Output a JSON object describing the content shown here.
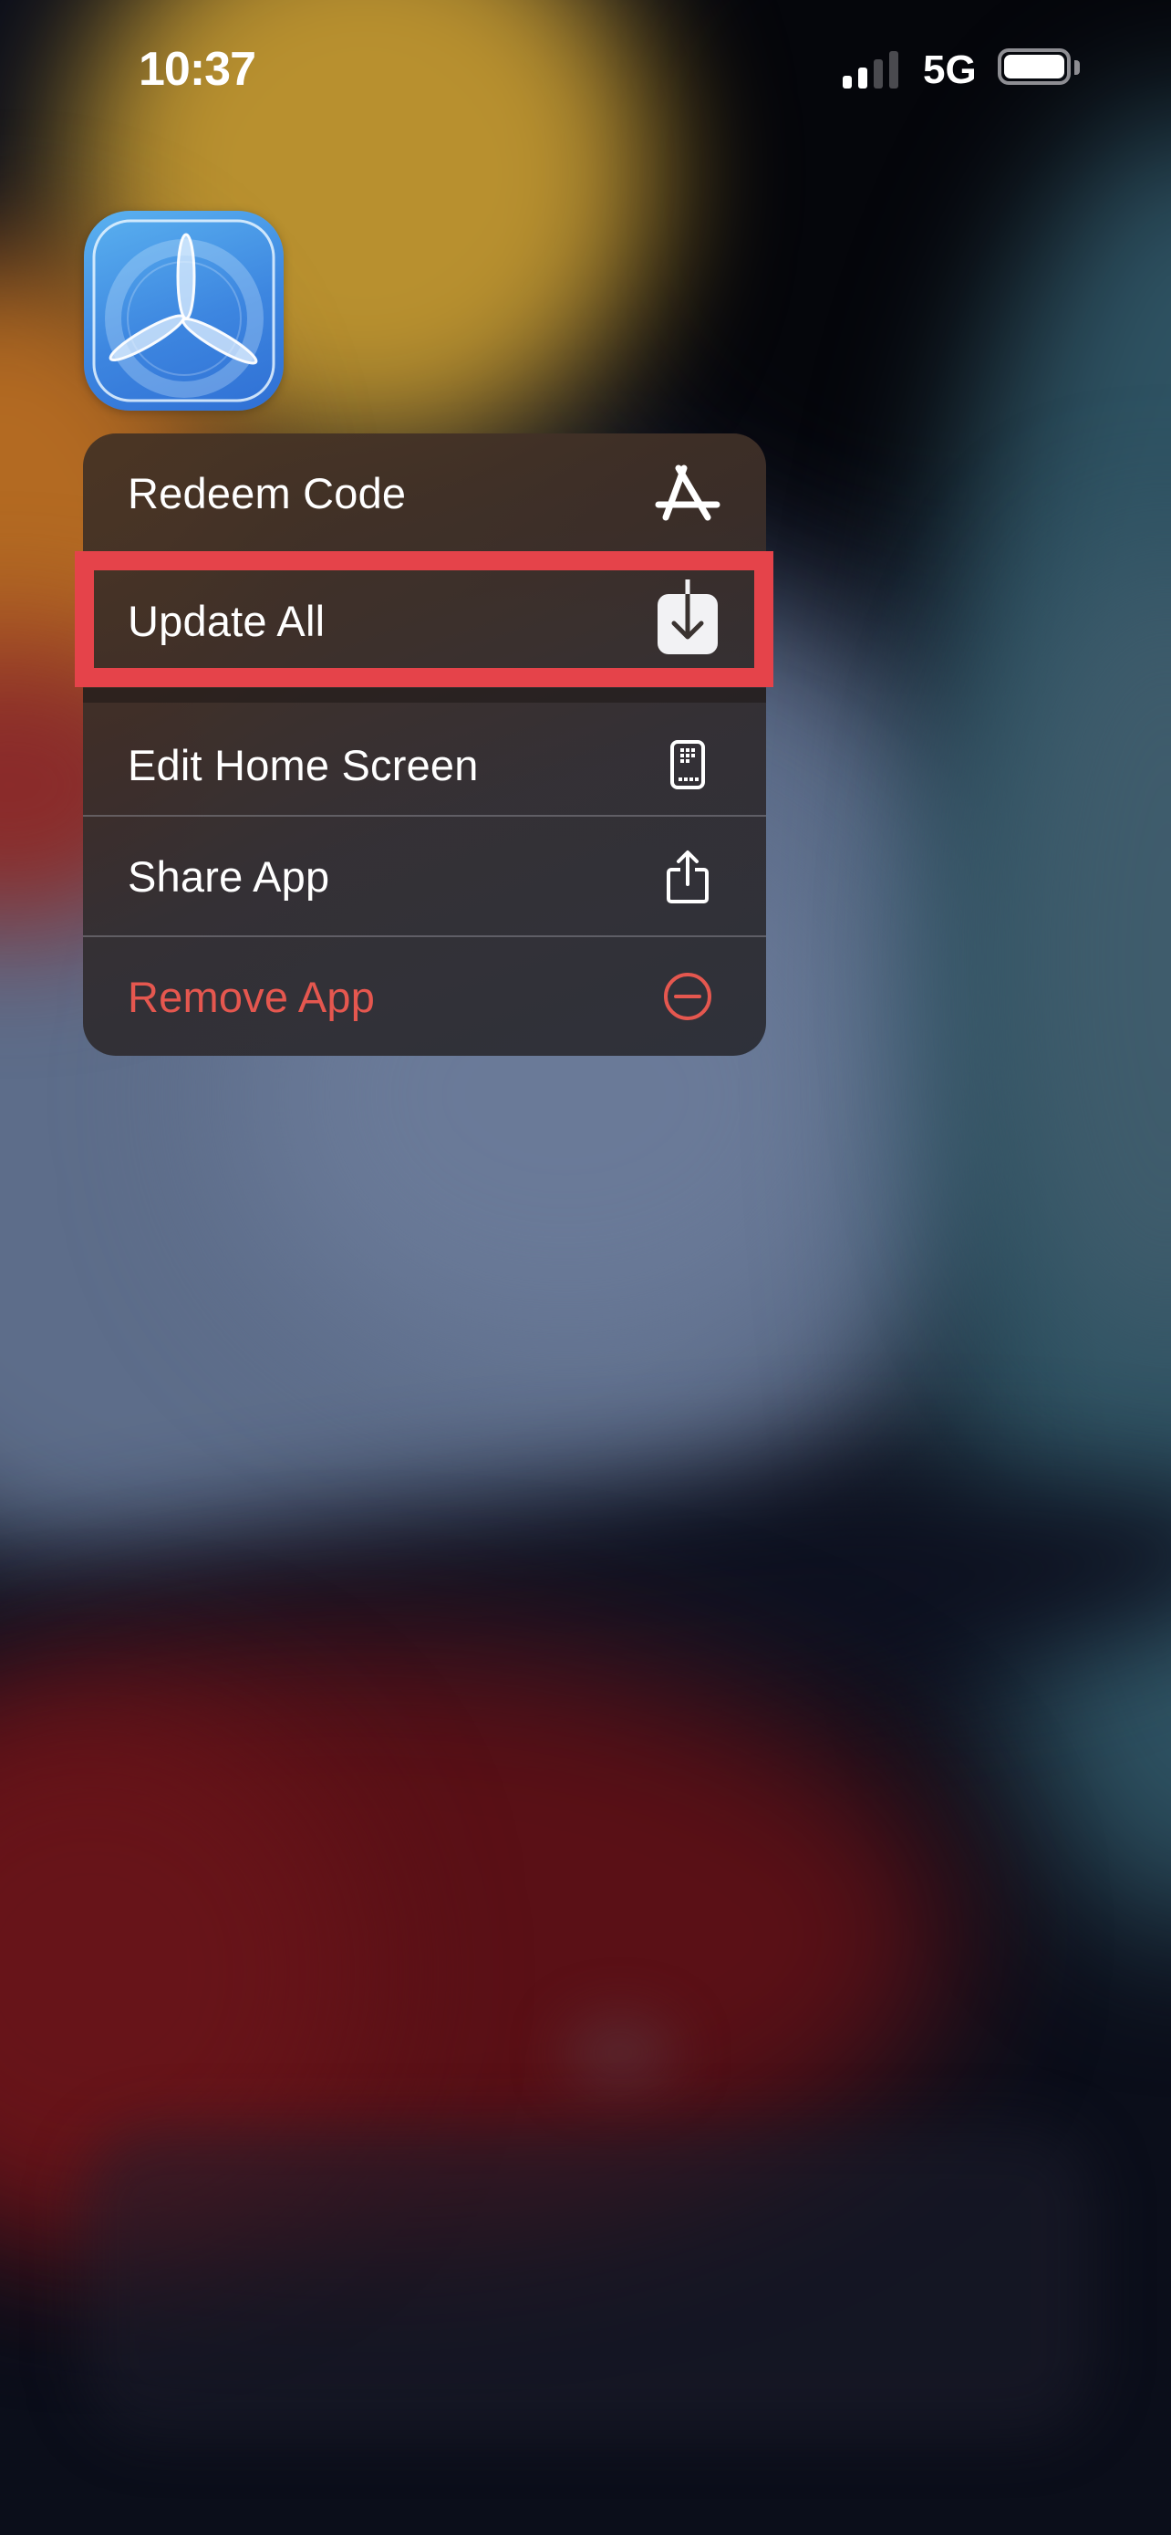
{
  "status_bar": {
    "time": "10:37",
    "network": "5G",
    "signal_bars_active": 2,
    "signal_bars_total": 4,
    "battery_level": 1.0
  },
  "app": {
    "name": "TestFlight",
    "icon": "testflight-propeller-icon"
  },
  "context_menu": {
    "groups": [
      {
        "items": [
          {
            "label": "Redeem Code",
            "icon": "app-store-icon",
            "destructive": false
          },
          {
            "label": "Update All",
            "icon": "download-icon",
            "destructive": false,
            "highlighted": true
          }
        ]
      },
      {
        "items": [
          {
            "label": "Edit Home Screen",
            "icon": "phone-grid-icon",
            "destructive": false
          },
          {
            "label": "Share App",
            "icon": "share-icon",
            "destructive": false
          },
          {
            "label": "Remove App",
            "icon": "minus-circle-icon",
            "destructive": true
          }
        ]
      }
    ]
  },
  "colors": {
    "highlight_box": "#e5434a",
    "destructive": "#e5574f",
    "menu_text": "#ffffff",
    "app_icon_blue": "#3d86e0"
  }
}
